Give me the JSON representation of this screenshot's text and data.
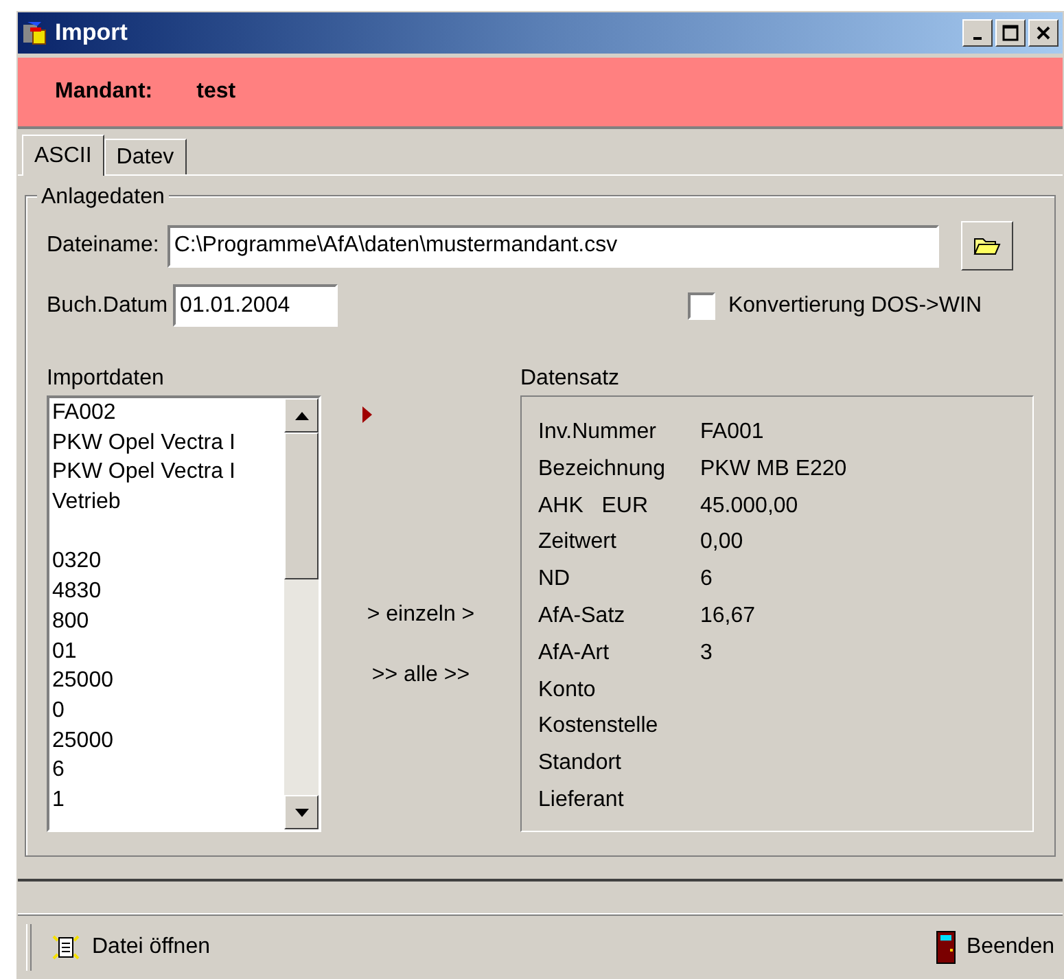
{
  "window": {
    "title": "Import"
  },
  "mandant": {
    "label": "Mandant:",
    "value": "test"
  },
  "tabs": [
    {
      "label": "ASCII",
      "selected": true
    },
    {
      "label": "Datev",
      "selected": false
    }
  ],
  "group": {
    "title": "Anlagedaten"
  },
  "file": {
    "label": "Dateiname:",
    "value": "C:\\Programme\\AfA\\daten\\mustermandant.csv"
  },
  "date": {
    "label": "Buch.Datum",
    "value": "01.01.2004"
  },
  "convert": {
    "label": "Konvertierung DOS->WIN",
    "checked": false
  },
  "import_list": {
    "label": "Importdaten",
    "items": [
      {
        "kind": "text",
        "text": "FA002"
      },
      {
        "kind": "text",
        "text": "PKW Opel Vectra I"
      },
      {
        "kind": "text",
        "text": "PKW Opel Vectra I"
      },
      {
        "kind": "text",
        "text": "Vetrieb"
      },
      {
        "kind": "blank"
      },
      {
        "kind": "text",
        "text": "0320"
      },
      {
        "kind": "text",
        "text": "4830"
      },
      {
        "kind": "text",
        "text": "800"
      },
      {
        "kind": "text",
        "text": "01"
      },
      {
        "kind": "text",
        "text": "25000"
      },
      {
        "kind": "text",
        "text": "0"
      },
      {
        "kind": "text",
        "text": "25000"
      },
      {
        "kind": "text",
        "text": "6"
      },
      {
        "kind": "text",
        "text": "1"
      }
    ]
  },
  "buttons": [
    "> einzeln >",
    ">> alle >>"
  ],
  "record": {
    "label": "Datensatz",
    "rows": [
      {
        "label": "Inv.Nummer",
        "value": "FA001"
      },
      {
        "label": "Bezeichnung",
        "value": "PKW MB E220"
      },
      {
        "label": "AHK   EUR",
        "value": "45.000,00"
      },
      {
        "label": "Zeitwert",
        "value": "0,00"
      },
      {
        "label": "ND",
        "value": "6"
      },
      {
        "label": "AfA-Satz",
        "value": "16,67"
      },
      {
        "label": "AfA-Art",
        "value": "3"
      },
      {
        "label": "Konto"
      },
      {
        "label": "Kostenstelle"
      },
      {
        "label": "Standort"
      },
      {
        "label": "Lieferant"
      }
    ]
  },
  "toolbar": [
    {
      "label": "Datei öffnen",
      "kind": "open"
    },
    {
      "label": "Beenden",
      "kind": "exit"
    }
  ]
}
